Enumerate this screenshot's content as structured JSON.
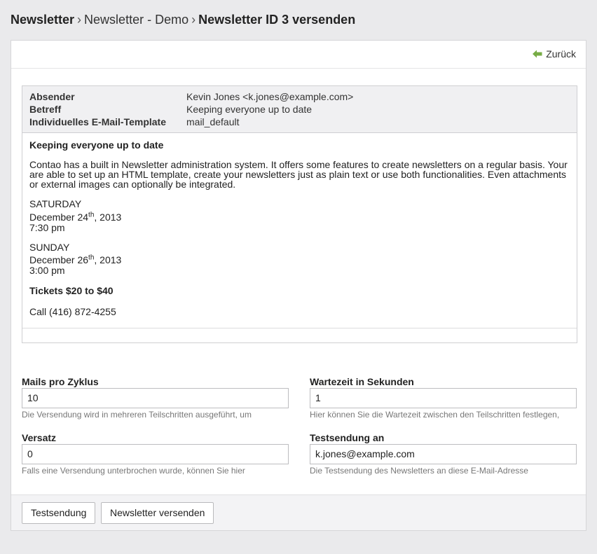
{
  "breadcrumb": {
    "root": "Newsletter",
    "channel": "Newsletter - Demo",
    "current": "Newsletter ID 3 versenden",
    "separator": "›"
  },
  "header": {
    "back_label": "Zurück",
    "back_icon": "back-arrow-icon",
    "accent": "#77ac45"
  },
  "preview": {
    "meta": [
      {
        "key": "Absender",
        "value": "Kevin Jones <k.jones@example.com>"
      },
      {
        "key": "Betreff",
        "value": "Keeping everyone up to date"
      },
      {
        "key": "Individuelles E-Mail-Template",
        "value": "mail_default"
      }
    ],
    "mail": {
      "title": "Keeping everyone up to date",
      "intro": "Contao has a built in Newsletter administration system. It offers some features to create newsletters on a regular basis. Your are able to set up an HTML template, create your newsletters just as plain text or use both functionalities. Even attachments or external images can optionally be integrated.",
      "event1": {
        "day": "SATURDAY",
        "date_prefix": "December 24",
        "date_sup": "th",
        "date_suffix": ", 2013",
        "time": "7:30 pm"
      },
      "event2": {
        "day": "SUNDAY",
        "date_prefix": "December 26",
        "date_sup": "th",
        "date_suffix": ", 2013",
        "time": "3:00 pm"
      },
      "tickets": "Tickets $20 to $40",
      "call": "Call (416) 872-4255"
    }
  },
  "form": {
    "mails_per_cycle": {
      "label": "Mails pro Zyklus",
      "value": "10",
      "help": "Die Versendung wird in mehreren Teilschritten ausgeführt, um"
    },
    "wait_time": {
      "label": "Wartezeit in Sekunden",
      "value": "1",
      "help": "Hier können Sie die Wartezeit zwischen den Teilschritten festlegen,"
    },
    "offset": {
      "label": "Versatz",
      "value": "0",
      "help": "Falls eine Versendung unterbrochen wurde, können Sie hier"
    },
    "test_recipient": {
      "label": "Testsendung an",
      "value": "k.jones@example.com",
      "help": "Die Testsendung des Newsletters an diese E-Mail-Adresse"
    }
  },
  "buttons": {
    "test": "Testsendung",
    "send": "Newsletter versenden"
  }
}
